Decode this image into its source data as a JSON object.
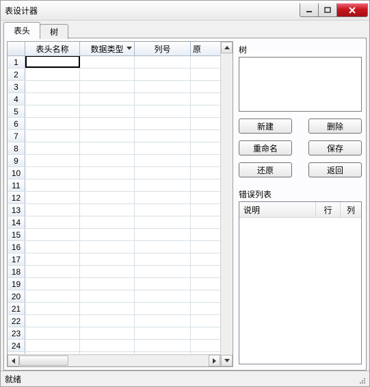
{
  "window": {
    "title": "表设计器"
  },
  "tabs": [
    {
      "label": "表头"
    },
    {
      "label": "树"
    }
  ],
  "grid": {
    "columns": [
      "表头名称",
      "数据类型",
      "列号",
      "原"
    ],
    "row_count": 26
  },
  "right": {
    "tree_label": "树",
    "buttons": {
      "new": "新建",
      "delete": "删除",
      "rename": "重命名",
      "save": "保存",
      "restore": "还原",
      "back": "返回"
    },
    "error_list_label": "错误列表",
    "error_columns": {
      "desc": "说明",
      "row": "行",
      "col": "列"
    }
  },
  "status": {
    "text": "就绪"
  }
}
